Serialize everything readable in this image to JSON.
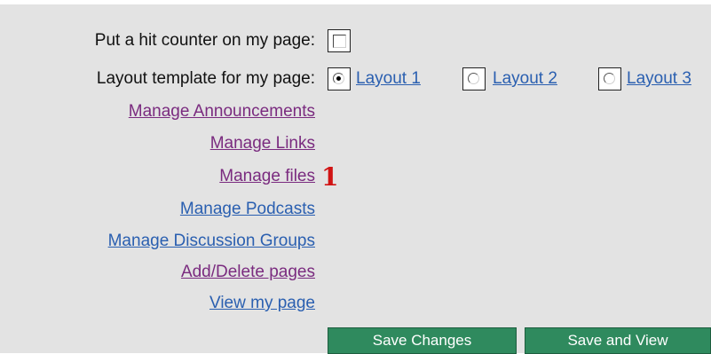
{
  "settings": {
    "hit_counter_label": "Put a hit counter on my page:",
    "hit_counter_checked": false,
    "layout_label": "Layout template for my page:",
    "layouts": [
      {
        "label": "Layout 1",
        "selected": true
      },
      {
        "label": "Layout 2",
        "selected": false
      },
      {
        "label": "Layout 3",
        "selected": false
      }
    ]
  },
  "links": [
    {
      "label": "Manage Announcements",
      "visited": true
    },
    {
      "label": "Manage Links",
      "visited": true
    },
    {
      "label": "Manage files",
      "visited": true
    },
    {
      "label": "Manage Podcasts",
      "visited": false
    },
    {
      "label": "Manage Discussion Groups",
      "visited": false
    },
    {
      "label": "Add/Delete pages",
      "visited": true
    },
    {
      "label": "View my page",
      "visited": false
    }
  ],
  "annotation": {
    "text": "1",
    "color": "#d11414"
  },
  "buttons": {
    "save_changes": "Save Changes",
    "save_and_view": "Save and View"
  },
  "colors": {
    "panel_bg": "#e3e3e3",
    "link_visited": "#7a2b7f",
    "link_unvisited": "#2a5fb0",
    "button_bg": "#2f8a5e"
  }
}
